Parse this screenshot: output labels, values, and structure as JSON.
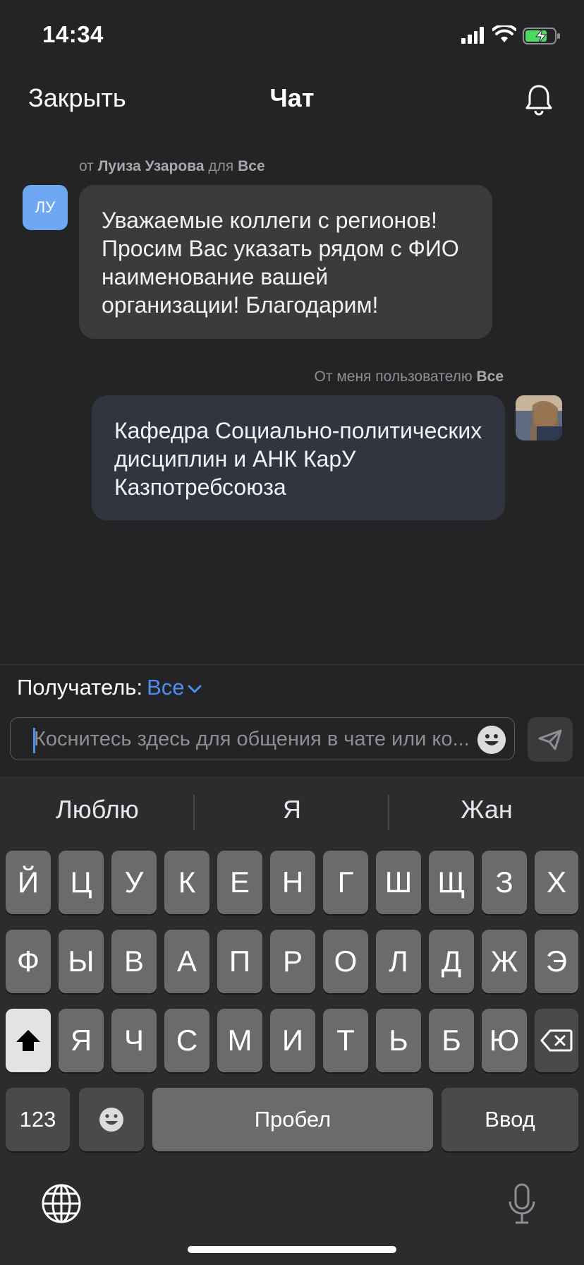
{
  "status_bar": {
    "time": "14:34"
  },
  "nav": {
    "close_label": "Закрыть",
    "title": "Чат"
  },
  "messages": [
    {
      "meta_prefix": "от",
      "meta_sender": "Луиза Узарова",
      "meta_to": "для",
      "meta_recipient": "Все",
      "avatar_initials": "ЛУ",
      "text": "Уважаемые коллеги с регионов! Просим Вас указать рядом с ФИО наименование вашей организации! Благодарим!"
    },
    {
      "meta_prefix": "От меня пользователю",
      "meta_recipient": "Все",
      "text": "Кафедра Социально-политических дисциплин и АНК КарУ Казпотребсоюза"
    }
  ],
  "composer": {
    "recipient_label": "Получатель:",
    "recipient_value": "Все",
    "input_placeholder": "Коснитесь здесь для общения в чате или ко...",
    "input_value": ""
  },
  "keyboard": {
    "suggestions": [
      "Люблю",
      "Я",
      "Жан"
    ],
    "rows": [
      [
        "Й",
        "Ц",
        "У",
        "К",
        "Е",
        "Н",
        "Г",
        "Ш",
        "Щ",
        "З",
        "Х"
      ],
      [
        "Ф",
        "Ы",
        "В",
        "А",
        "П",
        "Р",
        "О",
        "Л",
        "Д",
        "Ж",
        "Э"
      ],
      [
        "Я",
        "Ч",
        "С",
        "М",
        "И",
        "Т",
        "Ь",
        "Б",
        "Ю"
      ]
    ],
    "numbers_label": "123",
    "space_label": "Пробел",
    "return_label": "Ввод"
  },
  "colors": {
    "accent": "#4a8ff0",
    "background": "#242426",
    "incoming_bubble": "#3b3b3d",
    "outgoing_bubble": "#303540",
    "avatar": "#6ea8f3"
  }
}
